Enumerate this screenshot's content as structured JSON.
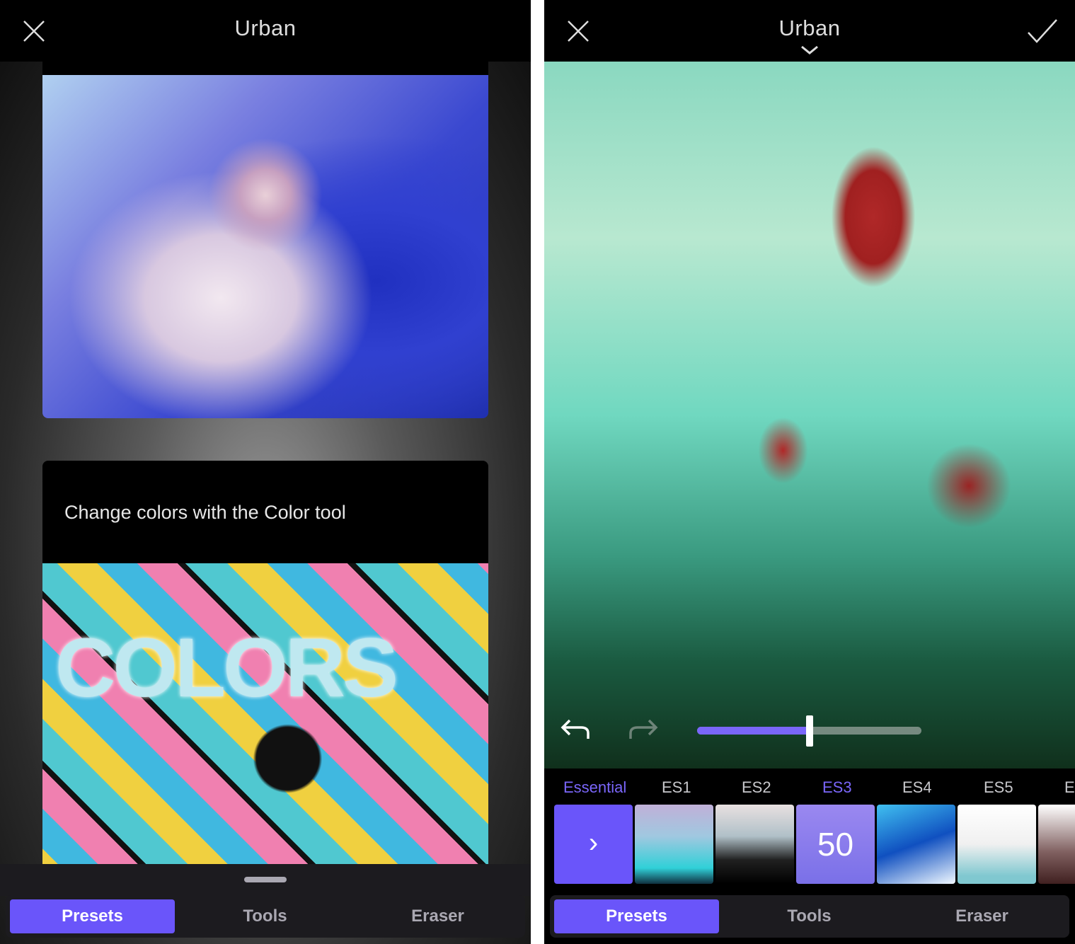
{
  "left": {
    "title": "Urban",
    "close_icon": "close-icon",
    "cards": [
      {
        "caption": ""
      },
      {
        "caption": "Change colors with the Color tool",
        "image_text": "COLORS"
      }
    ],
    "tabs": [
      {
        "label": "Presets",
        "active": true
      },
      {
        "label": "Tools"
      },
      {
        "label": "Eraser"
      }
    ]
  },
  "right": {
    "title": "Urban",
    "icons": {
      "close": "close-icon",
      "confirm": "checkmark-icon",
      "dropdown": "chevron-down-icon",
      "undo": "undo-icon",
      "redo": "redo-icon",
      "next": "chevron-right-icon"
    },
    "slider": {
      "value_percent": 50
    },
    "categories": [
      {
        "label": "Essential",
        "active": true
      },
      {
        "label": "ES1"
      },
      {
        "label": "ES2"
      },
      {
        "label": "ES3",
        "active": true
      },
      {
        "label": "ES4"
      },
      {
        "label": "ES5"
      },
      {
        "label": "E"
      }
    ],
    "selected_preset_value": "50",
    "next_glyph": "›",
    "tabs": [
      {
        "label": "Presets",
        "active": true
      },
      {
        "label": "Tools"
      },
      {
        "label": "Eraser"
      }
    ]
  },
  "colors": {
    "accent": "#6a55fa",
    "tab_bar": "#1c1b1f",
    "inactive_text": "#aaa8b2"
  }
}
